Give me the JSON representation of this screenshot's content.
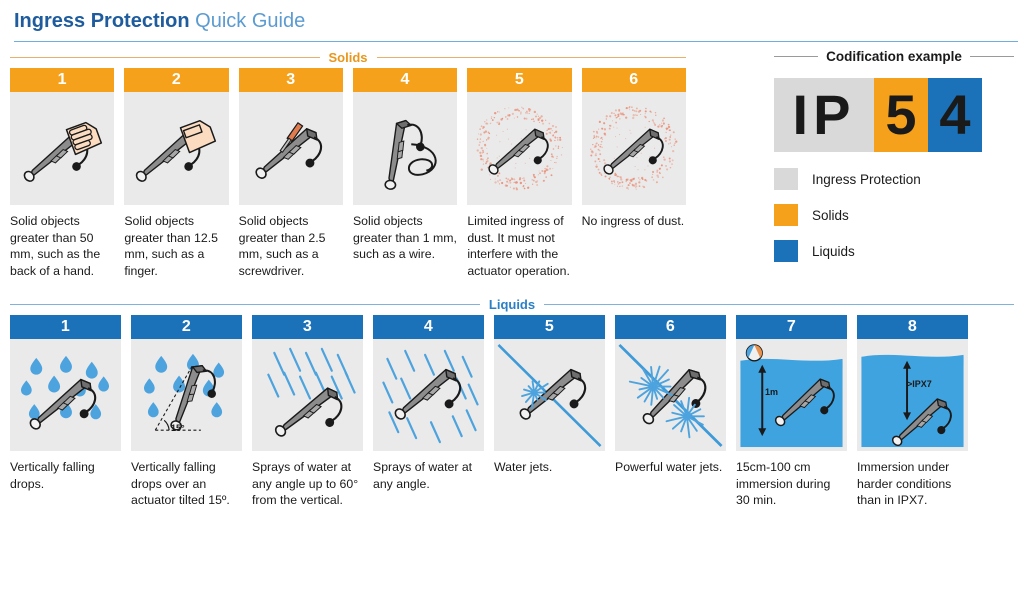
{
  "title": {
    "bold": "Ingress Protection",
    "light": "Quick Guide"
  },
  "colors": {
    "solids": "#F5A11B",
    "liquids": "#1C72B8",
    "ingress_protection": "#D9D9D9",
    "title_bold": "#1E5C9E",
    "title_light": "#5B9BD1",
    "cell_bg": "#EAEAEA"
  },
  "sections": {
    "solids": {
      "label": "Solids",
      "items": [
        {
          "number": "1",
          "desc": "Solid objects greater than 50 mm, such as the back of a hand.",
          "art": "hand-back"
        },
        {
          "number": "2",
          "desc": "Solid objects greater than 12.5 mm, such as a finger.",
          "art": "finger"
        },
        {
          "number": "3",
          "desc": "Solid objects greater than 2.5 mm, such as a screwdriver.",
          "art": "screwdriver"
        },
        {
          "number": "4",
          "desc": "Solid objects greater than 1 mm, such as a wire.",
          "art": "wire"
        },
        {
          "number": "5",
          "desc": "Limited ingress of dust. It must not interfere with the actuator operation.",
          "art": "dust-ring"
        },
        {
          "number": "6",
          "desc": "No ingress of dust.",
          "art": "dust-ring"
        }
      ]
    },
    "liquids": {
      "label": "Liquids",
      "items": [
        {
          "number": "1",
          "desc": "Vertically falling drops.",
          "art": "drops"
        },
        {
          "number": "2",
          "desc": "Vertically falling drops over an actuator tilted 15º.",
          "art": "drops-tilted",
          "art_label": "15°"
        },
        {
          "number": "3",
          "desc": "Sprays of water at any angle up to 60° from the vertical.",
          "art": "spray-60"
        },
        {
          "number": "4",
          "desc": "Sprays of water at any angle.",
          "art": "spray-all"
        },
        {
          "number": "5",
          "desc": "Water jets.",
          "art": "jet"
        },
        {
          "number": "6",
          "desc": "Powerful water jets.",
          "art": "jet-powerful"
        },
        {
          "number": "7",
          "desc": "15cm-100 cm immersion during 30 min.",
          "art": "immersion",
          "art_label": "1m"
        },
        {
          "number": "8",
          "desc": "Immersion under harder conditions than in IPX7.",
          "art": "immersion-deep",
          "art_label": ">IPX7"
        }
      ]
    }
  },
  "panel": {
    "label": "Codification example",
    "code": {
      "prefix": "IP",
      "solids_digit": "5",
      "liquids_digit": "4"
    },
    "legend": [
      {
        "label": "Ingress Protection",
        "color": "#D9D9D9"
      },
      {
        "label": "Solids",
        "color": "#F5A11B"
      },
      {
        "label": "Liquids",
        "color": "#1C72B8"
      }
    ]
  }
}
